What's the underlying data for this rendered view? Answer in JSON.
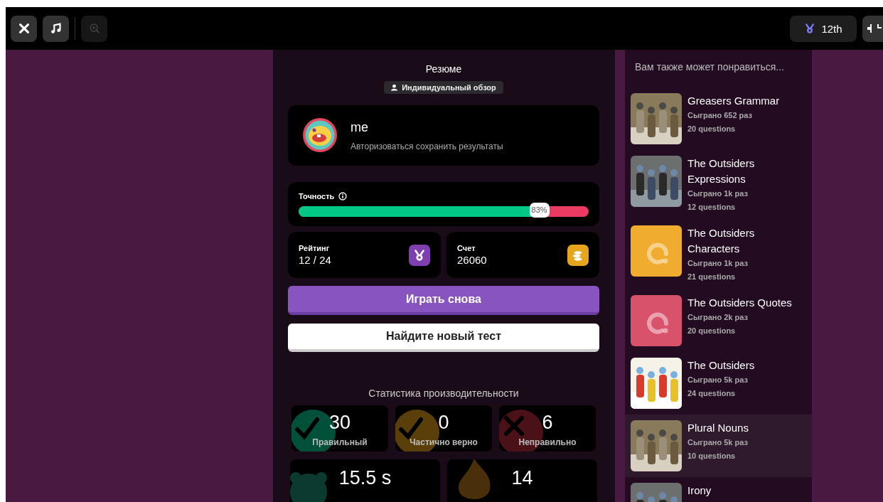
{
  "toolbar": {
    "buttons": [
      {
        "kind": "close",
        "disabled": false
      },
      {
        "kind": "music",
        "disabled": false
      },
      {
        "kind": "zoom",
        "disabled": true
      }
    ],
    "rank": "12th"
  },
  "summary": {
    "title": "Резюме",
    "mode": "Индивидуальный обзор",
    "player": {
      "name": "me",
      "hint": "Авторизоваться сохранить результаты"
    },
    "accuracy": {
      "label": "Точность",
      "level": 0.83,
      "reading": "83%"
    },
    "rank": {
      "label": "Рейтинг",
      "value": "12 / 24"
    },
    "score": {
      "label": "Счет",
      "value": "26060"
    },
    "buttons": [
      {
        "label": "Играть снова",
        "kind": "primary"
      },
      {
        "label": "Найдите новый тест",
        "kind": "secondary"
      }
    ],
    "stats_title": "Статистика производительности",
    "stats": [
      {
        "kind": "correct",
        "value": "30",
        "label": "Правильный",
        "color": "#00503a"
      },
      {
        "kind": "partial",
        "value": "0",
        "label": "Частично верно",
        "color": "#5a3f0a"
      },
      {
        "kind": "incorrect",
        "value": "6",
        "label": "Неправильно",
        "color": "#4a1218"
      }
    ],
    "more_stats": [
      {
        "kind": "time",
        "value": "15.5 s"
      },
      {
        "kind": "streak",
        "value": "14"
      }
    ]
  },
  "recommendations": {
    "title": "Вам также может понравиться...",
    "items": [
      {
        "title": "Greasers Grammar",
        "plays": "Сыграно 652 раз",
        "questions": "20 questions",
        "selected": false
      },
      {
        "title": "The Outsiders Expressions",
        "plays": "Сыграно 1k раз",
        "questions": "12 questions",
        "selected": false
      },
      {
        "title": "The Outsiders Characters",
        "plays": "Сыграно 1k раз",
        "questions": "21 questions",
        "thumb": {
          "kind": "placeholder",
          "color": "#efac2e"
        },
        "selected": false
      },
      {
        "title": "The Outsiders Quotes",
        "plays": "Сыграно 2k раз",
        "questions": "20 questions",
        "thumb": {
          "kind": "placeholder",
          "color": "#d9526c"
        },
        "selected": false
      },
      {
        "title": "The Outsiders",
        "plays": "Сыграно 5k раз",
        "questions": "24 questions",
        "selected": false
      },
      {
        "title": "Plural Nouns",
        "plays": "Сыграно 5k раз",
        "questions": "10 questions",
        "selected": true
      },
      {
        "title": "Irony",
        "selected": false
      }
    ]
  }
}
